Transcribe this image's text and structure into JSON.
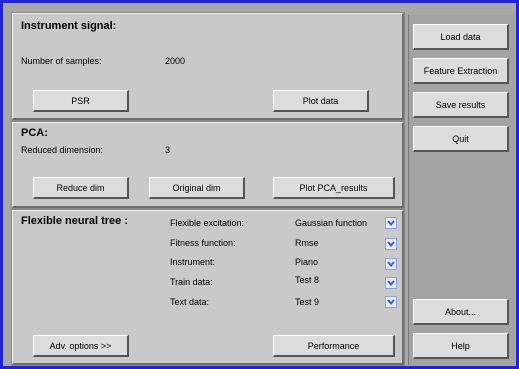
{
  "instrument_signal": {
    "title": "Instrument signal:",
    "samples_label": "Number of samples:",
    "samples_value": "2000",
    "psr_button": "PSR",
    "plot_button": "Plot data"
  },
  "pca": {
    "title": "PCA:",
    "reduced_label": "Reduced dimension:",
    "reduced_value": "3",
    "reduce_button": "Reduce dim",
    "original_button": "Original dim",
    "plot_button": "Plot PCA_results"
  },
  "fnt": {
    "title": "Flexible neural tree :",
    "params": [
      {
        "label": "Flexible   excitation:",
        "value": "Gaussian function"
      },
      {
        "label": "Fitness function:",
        "value": "Rmse"
      },
      {
        "label": "Instrument:",
        "value": "Piano"
      },
      {
        "label": "Train data:",
        "value": "Test 8"
      },
      {
        "label": "Text data:",
        "value": "Test 9"
      }
    ],
    "adv_button": "Adv. options >>",
    "performance_button": "Performance"
  },
  "sidebar": {
    "load": "Load data",
    "feature": "Feature Extraction",
    "save": "Save results",
    "quit": "Quit",
    "about": "About...",
    "help": "Help"
  },
  "colors": {
    "frame_border": "#2323d6",
    "panel_bg": "#c9c9c9",
    "dropdown_arrow": "#3a5fcf"
  },
  "icons": {
    "dropdown": "chevron-down-icon"
  }
}
